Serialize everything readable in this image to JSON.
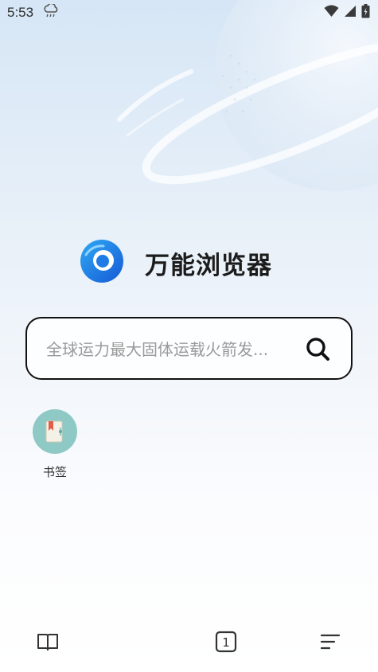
{
  "status_bar": {
    "time": "5:53",
    "weather_icon": "cloud-rain-icon",
    "icons": [
      "wifi-icon",
      "signal-icon",
      "battery-icon"
    ]
  },
  "app": {
    "title": "万能浏览器",
    "logo_icon": "browser-logo-icon"
  },
  "search": {
    "placeholder": "全球运力最大固体运载火箭发...",
    "button_icon": "search-icon"
  },
  "shortcuts": [
    {
      "label": "书签",
      "icon": "bookmark-book-icon",
      "color": "#8ec9c6"
    }
  ],
  "bottom_bar": {
    "bookmarks_icon": "book-icon",
    "tab_count": "1",
    "menu_icon": "menu-icon"
  },
  "colors": {
    "logo_blue": "#1e6fe0",
    "shortcut_bg": "#8ec9c6",
    "search_border": "#111111",
    "placeholder": "#9a9a9a"
  }
}
